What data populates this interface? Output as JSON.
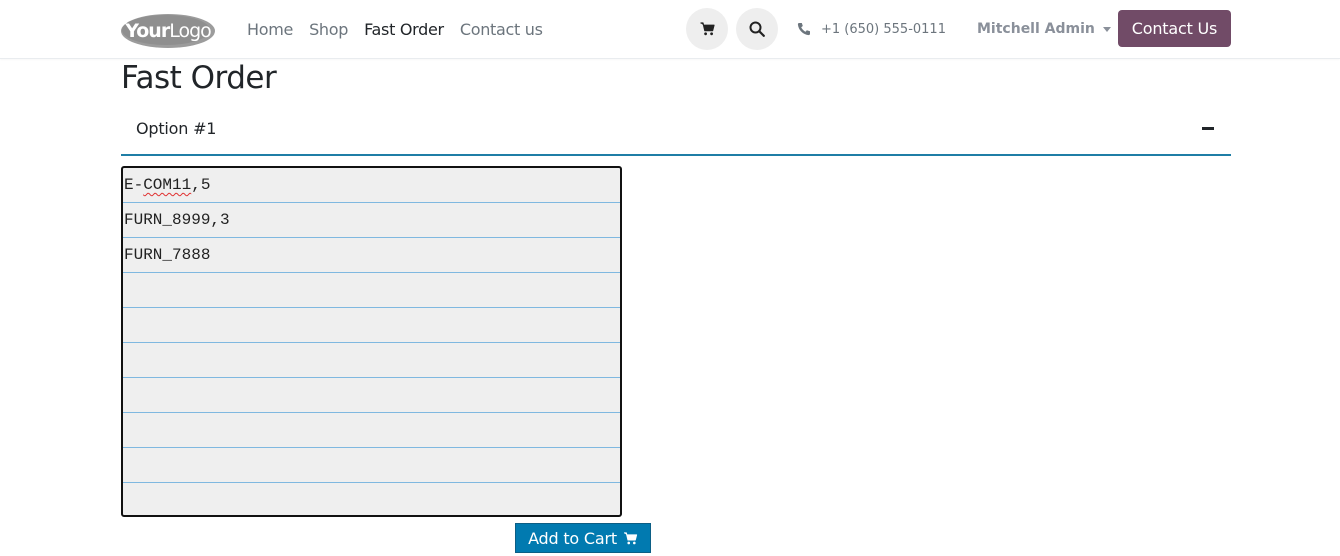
{
  "logo": {
    "part1": "Your",
    "part2": "Logo"
  },
  "nav": {
    "items": [
      {
        "label": "Home"
      },
      {
        "label": "Shop"
      },
      {
        "label": "Fast Order"
      },
      {
        "label": "Contact us"
      }
    ]
  },
  "header": {
    "phone": "+1 (650) 555-0111",
    "user": "Mitchell Admin",
    "contact_button": "Contact Us"
  },
  "page": {
    "title": "Fast Order",
    "accordion_label": "Option #1",
    "textarea_lines": [
      {
        "prefix": "E-",
        "flagged": "COM11",
        "suffix": ",5"
      },
      {
        "prefix": "FURN_8999,3",
        "flagged": "",
        "suffix": ""
      },
      {
        "prefix": "FURN_7888",
        "flagged": "",
        "suffix": ""
      }
    ],
    "add_to_cart": "Add to Cart"
  },
  "colors": {
    "brand": "#714B67",
    "primary_button": "#017ab0",
    "accordion_border": "#1f7ea6",
    "paper_rule": "#7fb8e0",
    "paper_background": "#efefef"
  },
  "icons": [
    "corner-resize-icon",
    "cart-icon",
    "search-icon",
    "phone-icon",
    "caret-down-icon",
    "minus-icon"
  ]
}
